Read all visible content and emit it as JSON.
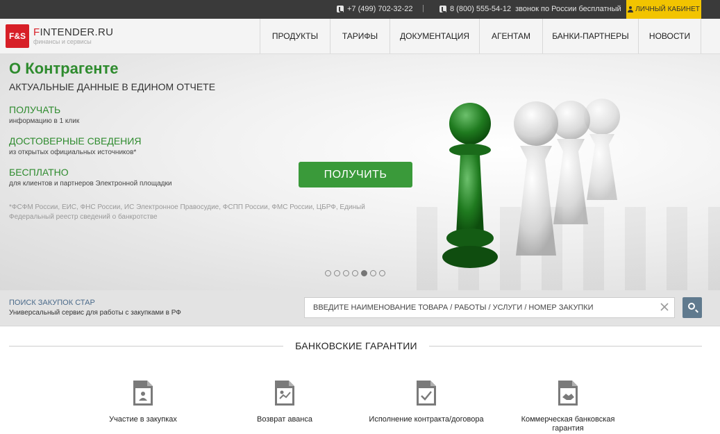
{
  "topbar": {
    "phone1": "+7 (499) 702-32-22",
    "separator": "|",
    "phone2": "8 (800) 555-54-12",
    "phone2_note": "звонок по России бесплатный",
    "cabinet": "ЛИЧНЫЙ КАБИНЕТ"
  },
  "header": {
    "logo_mark": "F&S",
    "logo_name": "FINTENDER.RU",
    "logo_tagline": "финансы и сервисы",
    "nav": [
      {
        "label": "ПРОДУКТЫ"
      },
      {
        "label": "ТАРИФЫ"
      },
      {
        "label": "ДОКУМЕНТАЦИЯ"
      },
      {
        "label": "АГЕНТАМ"
      },
      {
        "label": "БАНКИ-ПАРТНЕРЫ"
      },
      {
        "label": "НОВОСТИ"
      }
    ]
  },
  "hero": {
    "title": "О Контрагенте",
    "subtitle": "АКТУАЛЬНЫЕ ДАННЫЕ В ЕДИНОМ ОТЧЕТЕ",
    "features": [
      {
        "heading": "ПОЛУЧАТЬ",
        "text": "информацию в 1 клик"
      },
      {
        "heading": "ДОСТОВЕРНЫЕ СВЕДЕНИЯ",
        "text": "из открытых официальных источников*"
      },
      {
        "heading": "БЕСПЛАТНО",
        "text": "для клиентов и партнеров Электронной площадки"
      }
    ],
    "note": "*ФСФМ России, ЕИС, ФНС России, ИС Электронное Правосудие, ФСПП России, ФМС России, ЦБРФ, Единый Федеральный реестр сведений о банкротстве",
    "cta": "ПОЛУЧИТЬ",
    "slides_total": 7,
    "slide_active": 5
  },
  "search": {
    "title": "ПОИСК ЗАКУПОК СТАР",
    "subtitle": "Универсальный сервис для работы с закупками в РФ",
    "placeholder": "ВВЕДИТЕ НАИМЕНОВАНИЕ ТОВАРА / РАБОТЫ / УСЛУГИ / НОМЕР ЗАКУПКИ"
  },
  "guarantees": {
    "title": "БАНКОВСКИЕ ГАРАНТИИ",
    "items": [
      {
        "label": "Участие в закупках",
        "icon": "document-people-icon"
      },
      {
        "label": "Возврат аванса",
        "icon": "document-money-icon"
      },
      {
        "label": "Исполнение контракта/договора",
        "icon": "document-check-icon"
      },
      {
        "label": "Коммерческая банковская гарантия",
        "icon": "document-handshake-icon"
      }
    ]
  },
  "colors": {
    "accent_green": "#2e8b2e",
    "cta_green": "#3a9a3a",
    "cabinet_yellow": "#f2c400",
    "brand_red": "#d71f27",
    "topbar": "#3a3a3a",
    "search_button": "#607a8e"
  }
}
